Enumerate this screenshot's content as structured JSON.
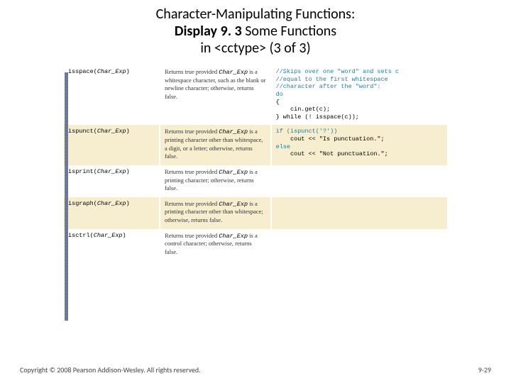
{
  "title": {
    "line1": "Character-Manipulating Functions:",
    "line2_bold": "Display 9. 3",
    "line2_rest": "  Some Functions",
    "line3": "in <cctype> (3 of 3)"
  },
  "rows": [
    {
      "fn": "isspace",
      "arg": "Char_Exp",
      "desc_pre": "Returns true provided",
      "desc_mid": "Char_Exp",
      "desc_post": " is a whitespace character, such as the blank or newline character; otherwise, returns false.",
      "example": {
        "comments": [
          "//Skips over one \"word\" and sets c",
          "//equal to the first whitespace",
          "//character after the \"word\":"
        ],
        "lines": [
          "do",
          "{",
          "    cin.get(c);",
          "} while (! isspace(c));"
        ]
      }
    },
    {
      "fn": "ispunct",
      "arg": "Char_Exp",
      "desc_pre": "Returns true provided",
      "desc_mid": "Char_Exp",
      "desc_post": " is a printing character other than whitespace, a digit, or a letter; otherwise, returns false.",
      "example": {
        "comments": [],
        "lines": [
          "if (ispunct('?'))",
          "    cout << \"Is punctuation.\";",
          "else",
          "    cout << \"Not punctuation.\";"
        ]
      }
    },
    {
      "fn": "isprint",
      "arg": "Char_Exp",
      "desc_pre": "Returns true provided",
      "desc_mid": "Char_Exp",
      "desc_post": " is a printing character; otherwise, returns false.",
      "example": {
        "comments": [],
        "lines": []
      }
    },
    {
      "fn": "isgraph",
      "arg": "Char_Exp",
      "desc_pre": "Returns true provided",
      "desc_mid": "Char_Exp",
      "desc_post": " is a printing character other than whitespace; otherwise, returns false.",
      "example": {
        "comments": [],
        "lines": []
      }
    },
    {
      "fn": "isctrl",
      "arg": "Char_Exp",
      "desc_pre": "Returns true provided",
      "desc_mid": "Char_Exp",
      "desc_post": " is a control character; otherwise, returns false.",
      "example": {
        "comments": [],
        "lines": []
      }
    }
  ],
  "footer": {
    "copyright": "Copyright © 2008 Pearson Addison-Wesley. All rights reserved.",
    "pagenum": "9-29"
  }
}
